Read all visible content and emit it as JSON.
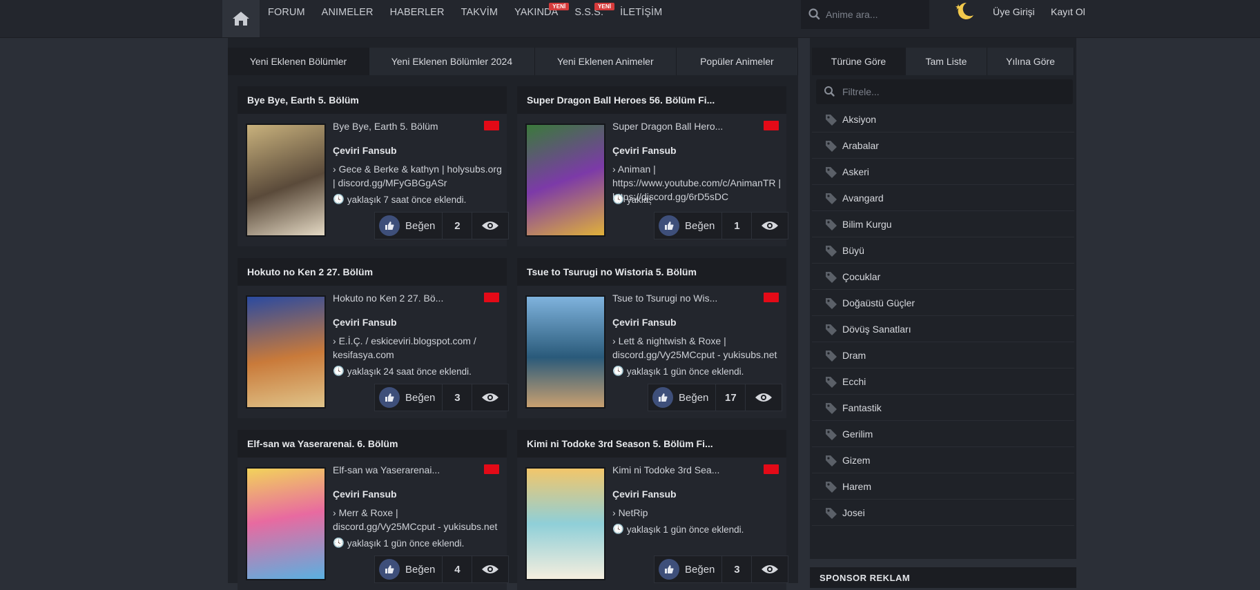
{
  "nav": {
    "items": [
      {
        "label": "FORUM",
        "badge": ""
      },
      {
        "label": "ANIMELER",
        "badge": ""
      },
      {
        "label": "HABERLER",
        "badge": ""
      },
      {
        "label": "TAKVİM",
        "badge": ""
      },
      {
        "label": "YAKINDA",
        "badge": "YENİ"
      },
      {
        "label": "S.S.S.",
        "badge": "YENİ"
      },
      {
        "label": "İLETİŞİM",
        "badge": ""
      }
    ],
    "search_placeholder": "Anime ara...",
    "login_label": "Üye Girişi",
    "register_label": "Kayıt Ol"
  },
  "main_tabs": [
    "Yeni Eklenen Bölümler",
    "Yeni Eklenen Bölümler 2024",
    "Yeni Eklenen Animeler",
    "Popüler Animeler"
  ],
  "cards": [
    {
      "header": "Bye Bye, Earth 5. Bölüm",
      "title": "Bye Bye, Earth 5. Bölüm",
      "fansub": "Çeviri Fansub",
      "translators": "Gece & Berke & kathyn | holysubs.org | discord.gg/MFyGBGgASr",
      "time": "yaklaşık 7 saat önce eklendi.",
      "like_label": "Beğen",
      "likes": "2",
      "poster_colors": [
        "#c9b27d",
        "#5a4a3a",
        "#e4d9c4"
      ]
    },
    {
      "header": "Super Dragon Ball Heroes 56. Bölüm Fi...",
      "title": "Super Dragon Ball Hero...",
      "fansub": "Çeviri Fansub",
      "translators": "Animan | https://www.youtube.com/c/AnimanTR | https://discord.gg/6rD5sDC",
      "time": "yaklaşık 1 gün önce eklendi.",
      "like_label": "Beğen",
      "likes": "1",
      "poster_colors": [
        "#3a7a3a",
        "#7c3aa8",
        "#e0b13a"
      ]
    },
    {
      "header": "Hokuto no Ken 2 27. Bölüm",
      "title": "Hokuto no Ken 2 27. Bö...",
      "fansub": "Çeviri Fansub",
      "translators": "E.İ.Ç. / eskiceviri.blogspot.com / kesifasya.com",
      "time": "yaklaşık 24 saat önce eklendi.",
      "like_label": "Beğen",
      "likes": "3",
      "poster_colors": [
        "#2a4aa0",
        "#c97a3a",
        "#e0c48a"
      ]
    },
    {
      "header": "Tsue to Tsurugi no Wistoria 5. Bölüm",
      "title": "Tsue to Tsurugi no Wis...",
      "fansub": "Çeviri Fansub",
      "translators": "Lett & nightwish & Roxe | discord.gg/Vy25MCcput - yukisubs.net",
      "time": "yaklaşık 1 gün önce eklendi.",
      "like_label": "Beğen",
      "likes": "17",
      "poster_colors": [
        "#7fb3dd",
        "#2a5a7a",
        "#c9a070"
      ]
    },
    {
      "header": "Elf-san wa Yaserarenai. 6. Bölüm",
      "title": "Elf-san wa Yaserarenai...",
      "fansub": "Çeviri Fansub",
      "translators": "Merr & Roxe | discord.gg/Vy25MCcput - yukisubs.net",
      "time": "yaklaşık 1 gün önce eklendi.",
      "like_label": "Beğen",
      "likes": "4",
      "poster_colors": [
        "#f2d35a",
        "#e86aa0",
        "#5ab0e0"
      ]
    },
    {
      "header": "Kimi ni Todoke 3rd Season 5. Bölüm Fi...",
      "title": "Kimi ni Todoke 3rd Sea...",
      "fansub": "Çeviri Fansub",
      "translators": "NetRip",
      "time": "yaklaşık 1 gün önce eklendi.",
      "like_label": "Beğen",
      "likes": "3",
      "poster_colors": [
        "#f2c66a",
        "#8fcfd8",
        "#f5eede"
      ]
    }
  ],
  "side_tabs": [
    "Türüne Göre",
    "Tam Liste",
    "Yılına Göre"
  ],
  "filter_placeholder": "Filtrele...",
  "genres": [
    "Aksiyon",
    "Arabalar",
    "Askeri",
    "Avangard",
    "Bilim Kurgu",
    "Büyü",
    "Çocuklar",
    "Doğaüstü Güçler",
    "Dövüş Sanatları",
    "Dram",
    "Ecchi",
    "Fantastik",
    "Gerilim",
    "Gizem",
    "Harem",
    "Josei"
  ],
  "sponsor_label": "SPONSOR REKLAM",
  "colors": {
    "background": "#2b2f37",
    "panel": "#1f2228",
    "like_accent": "#3e4f7a",
    "badge": "#d63b3b"
  }
}
